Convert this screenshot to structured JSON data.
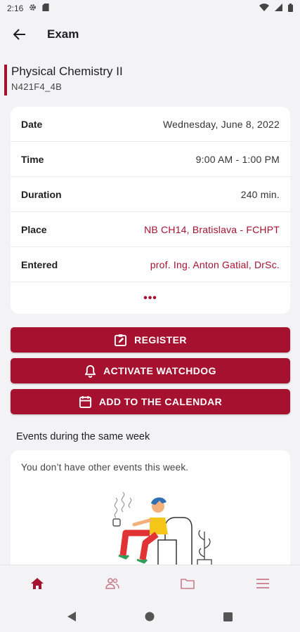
{
  "status_bar": {
    "time": "2:16"
  },
  "app_bar": {
    "title": "Exam"
  },
  "course": {
    "name": "Physical Chemistry II",
    "code": "N421F4_4B"
  },
  "details": [
    {
      "label": "Date",
      "value": "Wednesday, June 8, 2022",
      "link": false
    },
    {
      "label": "Time",
      "value": "9:00 AM - 1:00 PM",
      "link": false
    },
    {
      "label": "Duration",
      "value": "240 min.",
      "link": false
    },
    {
      "label": "Place",
      "value": "NB CH14, Bratislava - FCHPT",
      "link": true
    },
    {
      "label": "Entered",
      "value": "prof. Ing. Anton Gatial, DrSc.",
      "link": true
    }
  ],
  "more_label": "•••",
  "buttons": {
    "register": "REGISTER",
    "watchdog": "ACTIVATE WATCHDOG",
    "calendar": "ADD TO THE CALENDAR"
  },
  "events": {
    "section_title": "Events during the same week",
    "empty_text": "You don’t have other events this week."
  },
  "bottom_nav": [
    {
      "icon": "home-icon",
      "active": true
    },
    {
      "icon": "people-icon",
      "active": false
    },
    {
      "icon": "folder-icon",
      "active": false
    },
    {
      "icon": "menu-icon",
      "active": false
    }
  ],
  "colors": {
    "accent": "#a5112f",
    "background": "#f3f3f5",
    "card": "#ffffff",
    "inactive_icon": "#c97a8a"
  }
}
